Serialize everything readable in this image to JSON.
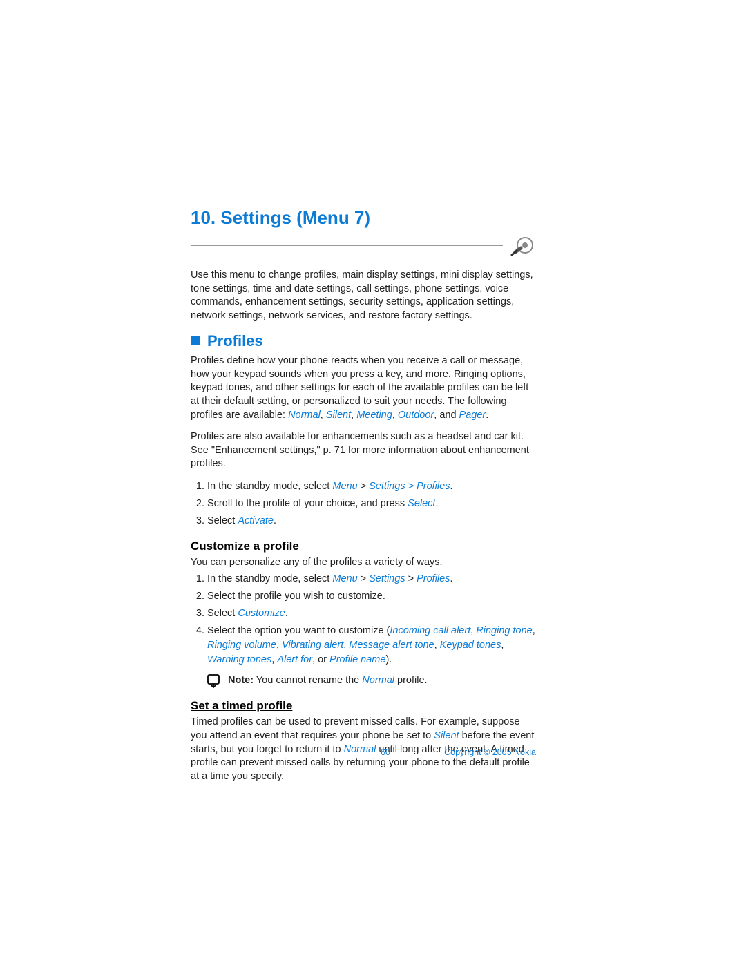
{
  "chapter": "10. Settings (Menu 7)",
  "intro": "Use this menu to change profiles, main display settings, mini display settings, tone settings, time and date settings, call settings, phone settings, voice commands, enhancement settings, security settings, application settings, network settings, network services, and restore factory settings.",
  "section_profiles": "Profiles",
  "profiles_p1_a": "Profiles define how your phone reacts when you receive a call or message, how your keypad sounds when you press a key, and more. Ringing options, keypad tones, and other settings for each of the available profiles can be left at their default setting, or personalized to suit your needs. The following profiles are available: ",
  "profiles_list": {
    "normal": "Normal",
    "silent": "Silent",
    "meeting": "Meeting",
    "outdoor": "Outdoor",
    "pager": "Pager"
  },
  "profiles_p2": "Profiles are also available for enhancements such as a headset and car kit. See \"Enhancement settings,\" p. 71 for more information about enhancement profiles.",
  "steps1": {
    "s1a": "In the standby mode, select ",
    "s1b": "Menu",
    "s1c": "Settings > Profiles",
    "s2a": "Scroll to the profile of your choice, and press ",
    "s2b": "Select",
    "s3a": "Select ",
    "s3b": "Activate"
  },
  "sub_customize": "Customize a profile",
  "customize_p": "You can personalize any of the profiles a variety of ways.",
  "steps2": {
    "s1a": "In the standby mode, select ",
    "s1b": "Menu",
    "s1c": "Settings",
    "s1d": "Profiles",
    "s2": "Select the profile you wish to customize.",
    "s3a": "Select ",
    "s3b": "Customize",
    "s4a": "Select the option you want to customize (",
    "s4_items": {
      "i1": "Incoming call alert",
      "i2": "Ringing tone",
      "i3": "Ringing volume",
      "i4": "Vibrating alert",
      "i5": "Message alert tone",
      "i6": "Keypad tones",
      "i7": "Warning tones",
      "i8": "Alert for",
      "i9": "Profile name"
    },
    "s4b": ", or ",
    "s4c": ")."
  },
  "note_label": "Note:",
  "note_a": " You cannot rename the ",
  "note_b": "Normal",
  "note_c": " profile.",
  "sub_timed": "Set a timed profile",
  "timed_a": "Timed profiles can be used to prevent missed calls. For example, suppose you attend an event that requires your phone be set to ",
  "timed_b": "Silent",
  "timed_c": " before the event starts, but you forget to return it to ",
  "timed_d": "Normal",
  "timed_e": " until long after the event. A timed profile can prevent missed calls by returning your phone to the default profile at a time you specify.",
  "page_num": "60",
  "copyright": "Copyright © 2005 Nokia"
}
